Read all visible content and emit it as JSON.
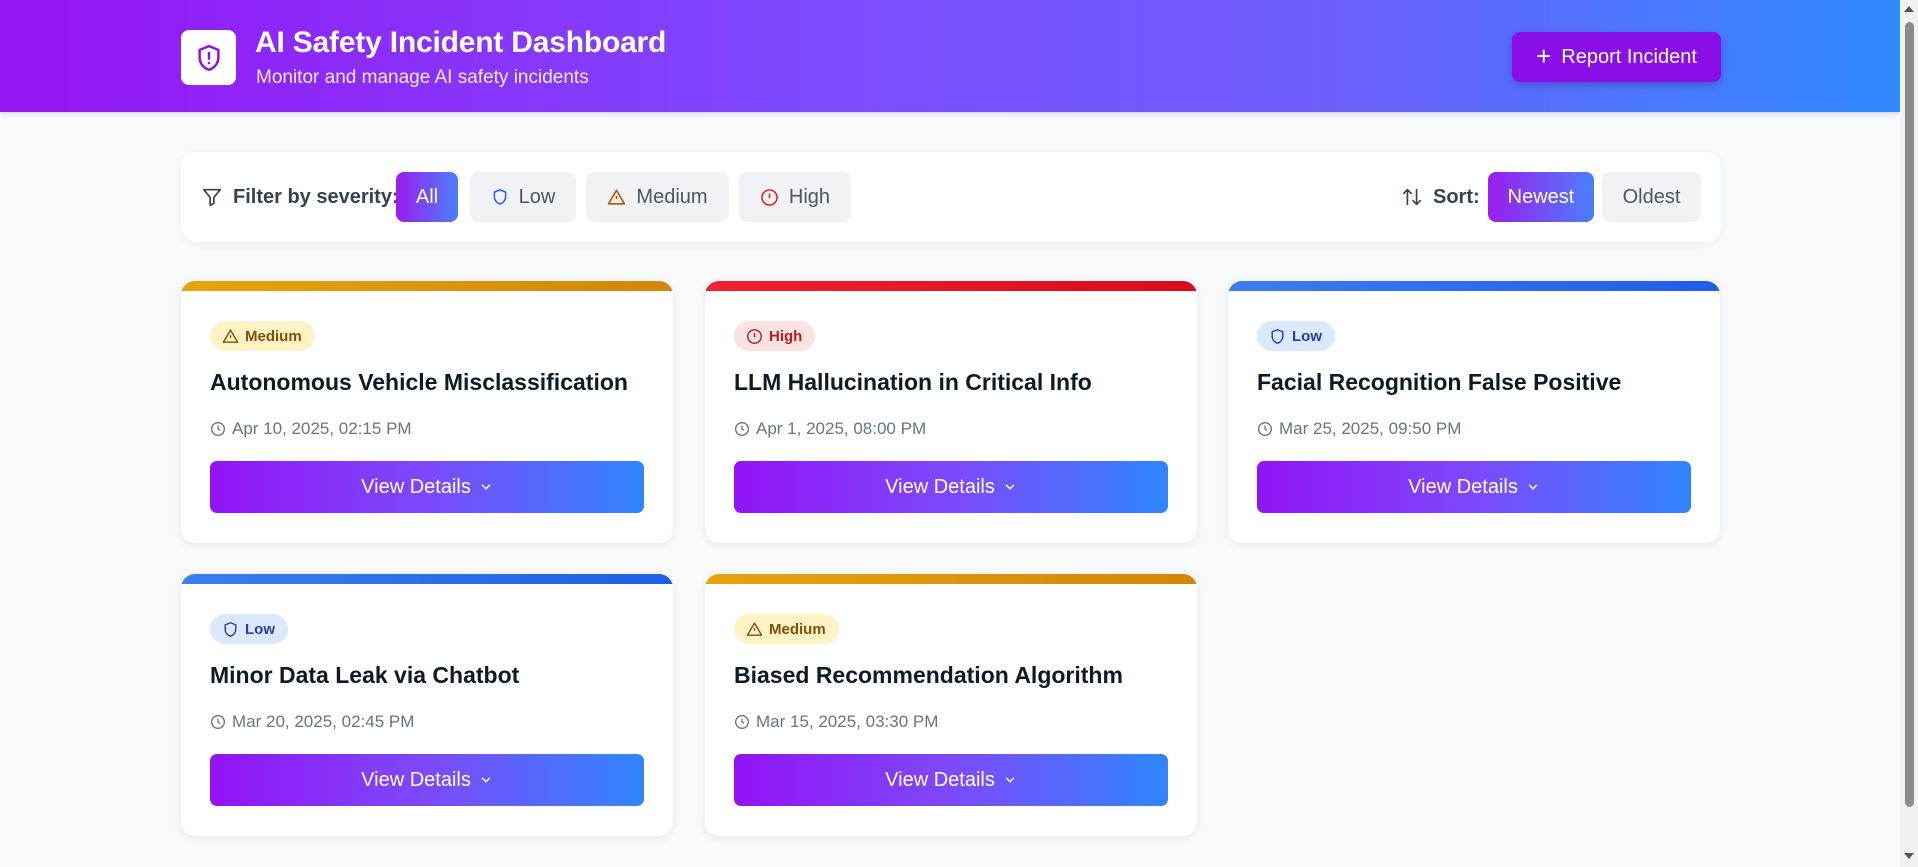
{
  "header": {
    "title": "AI Safety Incident Dashboard",
    "subtitle": "Monitor and manage AI safety incidents",
    "report_button_label": "Report Incident"
  },
  "filter": {
    "label": "Filter by severity:",
    "options": [
      {
        "label": "All",
        "icon": "",
        "active": true
      },
      {
        "label": "Low",
        "icon": "shield-icon",
        "active": false
      },
      {
        "label": "Medium",
        "icon": "warning-triangle-icon",
        "active": false
      },
      {
        "label": "High",
        "icon": "alert-circle-icon",
        "active": false
      }
    ]
  },
  "sort": {
    "label": "Sort:",
    "options": [
      {
        "label": "Newest",
        "active": true
      },
      {
        "label": "Oldest",
        "active": false
      }
    ]
  },
  "incidents": [
    {
      "severity": "Medium",
      "title": "Autonomous Vehicle Misclassification",
      "date": "Apr 10, 2025, 02:15 PM",
      "button": "View Details"
    },
    {
      "severity": "High",
      "title": "LLM Hallucination in Critical Info",
      "date": "Apr 1, 2025, 08:00 PM",
      "button": "View Details"
    },
    {
      "severity": "Low",
      "title": "Facial Recognition False Positive",
      "date": "Mar 25, 2025, 09:50 PM",
      "button": "View Details"
    },
    {
      "severity": "Low",
      "title": "Minor Data Leak via Chatbot",
      "date": "Mar 20, 2025, 02:45 PM",
      "button": "View Details"
    },
    {
      "severity": "Medium",
      "title": "Biased Recommendation Algorithm",
      "date": "Mar 15, 2025, 03:30 PM",
      "button": "View Details"
    }
  ],
  "colors": {
    "header_gradient_start": "#9614f5",
    "header_gradient_end": "#2f8bff",
    "medium": "#e6a40c",
    "high": "#ee2233",
    "low": "#3a7ef0"
  }
}
